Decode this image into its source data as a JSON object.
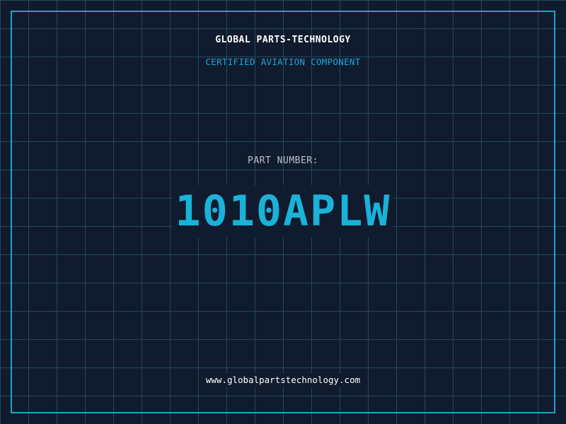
{
  "header": {
    "company": "GLOBAL PARTS-TECHNOLOGY",
    "subtitle": "CERTIFIED AVIATION COMPONENT"
  },
  "part": {
    "label": "PART NUMBER:",
    "number": "1010APLW"
  },
  "footer": {
    "website": "www.globalpartstechnology.com"
  },
  "colors": {
    "background": "#111b2e",
    "grid": "#1f4a5e",
    "frame": "#1aa6c8",
    "accent": "#1ab2d8"
  }
}
